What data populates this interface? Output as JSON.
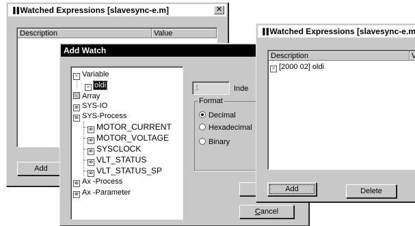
{
  "back_window": {
    "title": "Watched Expressions [slavesync-e.m]",
    "close_label": "✕",
    "columns": [
      "Description",
      "Value"
    ],
    "add_label": "Add"
  },
  "add_watch": {
    "title": "Add Watch",
    "tree": [
      {
        "label": "Variable",
        "icon": "variable-icon"
      },
      {
        "label": "oldi",
        "icon": "variable-icon",
        "selected": true
      },
      {
        "label": "Array",
        "icon": "array-icon"
      },
      {
        "label": "SYS-IO",
        "icon": "io-icon"
      },
      {
        "label": "SYS-Process",
        "icon": "io-icon"
      },
      {
        "label": "MOTOR_CURRENT",
        "icon": "io-icon"
      },
      {
        "label": "MOTOR_VOLTAGE",
        "icon": "io-icon"
      },
      {
        "label": "SYSCLOCK",
        "icon": "io-icon"
      },
      {
        "label": "VLT_STATUS",
        "icon": "io-icon"
      },
      {
        "label": "VLT_STATUS_SP",
        "icon": "io-icon"
      },
      {
        "label": "Ax -Process",
        "icon": "io-icon"
      },
      {
        "label": "Ax -Parameter",
        "icon": "io-icon"
      }
    ],
    "index_value": "1",
    "index_label": "Inde",
    "format_label": "Format",
    "formats": [
      {
        "label": "Decimal",
        "checked": true
      },
      {
        "label": "Hexadecimal",
        "checked": false
      },
      {
        "label": "Binary",
        "checked": false
      }
    ],
    "cancel_label": "Cancel"
  },
  "front_window": {
    "title": "Watched Expressions [slavesync-e.m",
    "columns": [
      "Description",
      "V"
    ],
    "rows": [
      {
        "description": "[2000 02] oldi"
      }
    ],
    "add_label": "Add",
    "delete_label": "Delete"
  }
}
